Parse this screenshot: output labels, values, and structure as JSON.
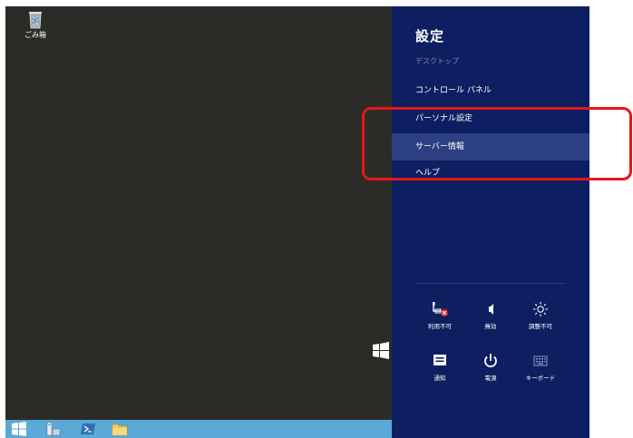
{
  "desktop": {
    "recycle_bin_label": "ごみ箱"
  },
  "charms": {
    "title": "設定",
    "subtitle": "デスクトップ",
    "menu": [
      {
        "label": "コントロール パネル",
        "selected": false
      },
      {
        "label": "パーソナル設定",
        "selected": false
      },
      {
        "label": "サーバー情報",
        "selected": true
      },
      {
        "label": "ヘルプ",
        "selected": false
      }
    ],
    "quick_settings": [
      {
        "label": "利用不可",
        "icon": "network-unavailable-icon"
      },
      {
        "label": "無効",
        "icon": "volume-icon"
      },
      {
        "label": "調整不可",
        "icon": "brightness-icon"
      },
      {
        "label": "通知",
        "icon": "notifications-icon"
      },
      {
        "label": "電源",
        "icon": "power-icon"
      },
      {
        "label": "キーボード",
        "icon": "keyboard-icon"
      }
    ]
  },
  "colors": {
    "charm_bg": "#0d1f61",
    "selected_bg": "#2c3f81",
    "desktop_bg": "#2b2c27",
    "taskbar_bg": "#5aa9d8",
    "highlight": "#e8141c"
  }
}
